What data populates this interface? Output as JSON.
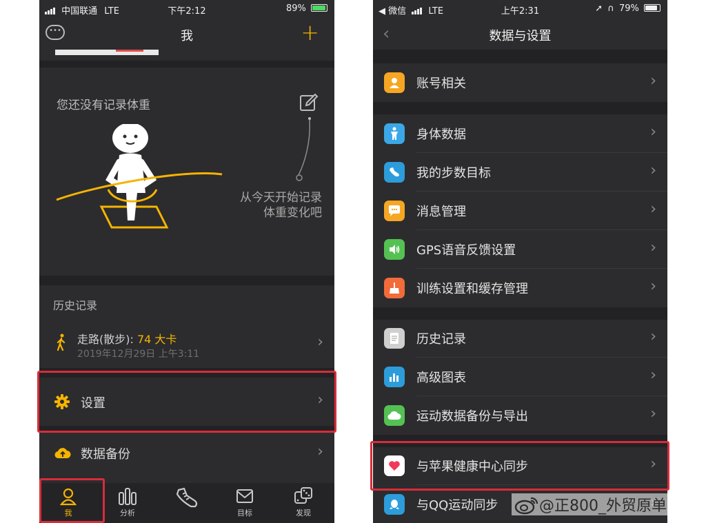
{
  "left": {
    "status": {
      "carrier": "中国联通",
      "network": "LTE",
      "time": "下午2:12",
      "battery": "89%"
    },
    "title": "我",
    "weight": {
      "empty_message": "您还没有记录体重",
      "hint": "从今天开始记录体重变化吧"
    },
    "history": {
      "heading": "历史记录",
      "record": {
        "activity": "走路(散步): ",
        "calories": "74 大卡",
        "time": "2019年12月29日 上午3:11"
      }
    },
    "settings_label": "设置",
    "backup_label": "数据备份",
    "tabs": [
      {
        "label": "我",
        "icon": "person-icon"
      },
      {
        "label": "分析",
        "icon": "bar-chart-icon"
      },
      {
        "label": "",
        "icon": "shoe-icon"
      },
      {
        "label": "目标",
        "icon": "envelope-target-icon"
      },
      {
        "label": "发现",
        "icon": "dice-icon"
      }
    ],
    "accent": "#f5b400"
  },
  "right": {
    "status": {
      "app_back": "◀ 微信",
      "network": "LTE",
      "time": "上午2:31",
      "battery": "79%"
    },
    "title": "数据与设置",
    "groups": [
      [
        {
          "label": "账号相关",
          "icon": "person-icon",
          "color": "#f5a623"
        }
      ],
      [
        {
          "label": "身体数据",
          "icon": "body-icon",
          "color": "#3ba7e6"
        },
        {
          "label": "我的步数目标",
          "icon": "shoe-icon",
          "color": "#2d9cdb"
        },
        {
          "label": "消息管理",
          "icon": "message-icon",
          "color": "#f5a623"
        },
        {
          "label": "GPS语音反馈设置",
          "icon": "speaker-icon",
          "color": "#54c152"
        },
        {
          "label": "训练设置和缓存管理",
          "icon": "broom-icon",
          "color": "#f26b3a"
        }
      ],
      [
        {
          "label": "历史记录",
          "icon": "document-icon",
          "color": "#cfcfcf"
        },
        {
          "label": "高级图表",
          "icon": "chart-icon",
          "color": "#2d9cdb"
        },
        {
          "label": "运动数据备份与导出",
          "icon": "cloud-icon",
          "color": "#54c152"
        }
      ],
      [
        {
          "label": "与苹果健康中心同步",
          "icon": "heart-icon",
          "color": "#ffffff"
        },
        {
          "label": "与QQ运动同步",
          "icon": "qq-icon",
          "color": "#2d9cdb"
        }
      ]
    ]
  },
  "watermark": "@正800_外贸原单",
  "highlight_color": "#d92c3a"
}
